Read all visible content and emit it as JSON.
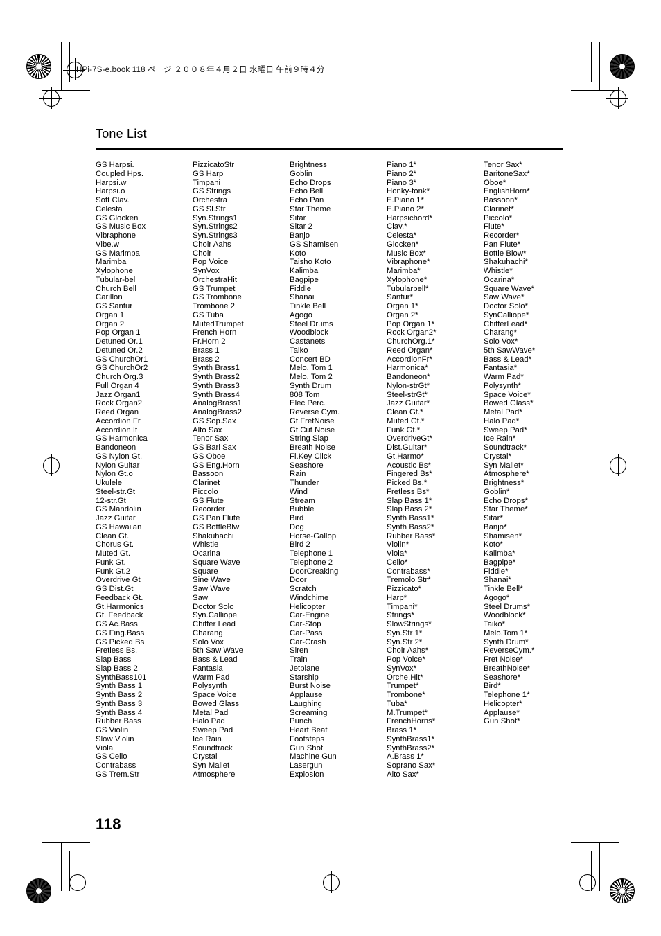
{
  "imposition": {
    "text": "HPi-7S-e.book  118 ページ  ２００８年４月２日  水曜日  午前９時４分"
  },
  "document": {
    "title": "Tone List",
    "page_number": "118"
  },
  "columns": [
    {
      "id": "column-1",
      "items": [
        "GS Harpsi.",
        "Coupled Hps.",
        "Harpsi.w",
        "Harpsi.o",
        "Soft Clav.",
        "Celesta",
        "GS Glocken",
        "GS Music Box",
        "Vibraphone",
        "Vibe.w",
        "GS Marimba",
        "Marimba",
        "Xylophone",
        "Tubular-bell",
        "Church Bell",
        "Carillon",
        "GS Santur",
        "Organ 1",
        "Organ 2",
        "Pop Organ 1",
        "Detuned Or.1",
        "Detuned Or.2",
        "GS ChurchOr1",
        "GS ChurchOr2",
        "Church Org.3",
        "Full Organ 4",
        "Jazz Organ1",
        "Rock Organ2",
        "Reed Organ",
        "Accordion Fr",
        "Accordion It",
        "GS Harmonica",
        "Bandoneon",
        "GS Nylon Gt.",
        "Nylon Guitar",
        "Nylon Gt.o",
        "Ukulele",
        "Steel-str.Gt",
        "12-str.Gt",
        "GS Mandolin",
        "Jazz Guitar",
        "GS Hawaiian",
        "Clean Gt.",
        "Chorus Gt.",
        "Muted Gt.",
        "Funk Gt.",
        "Funk Gt.2",
        "Overdrive Gt",
        "GS Dist.Gt",
        "Feedback Gt.",
        "Gt.Harmonics",
        "Gt. Feedback",
        "GS Ac.Bass",
        "GS Fing.Bass",
        "GS Picked Bs",
        "Fretless Bs.",
        "Slap Bass",
        "Slap Bass 2",
        "SynthBass101",
        "Synth Bass 1",
        "Synth Bass 2",
        "Synth Bass 3",
        "Synth Bass 4",
        "Rubber Bass",
        "GS Violin",
        "Slow Violin",
        "Viola",
        "GS Cello",
        "Contrabass",
        "GS Trem.Str"
      ]
    },
    {
      "id": "column-2",
      "items": [
        "PizzicatoStr",
        "GS Harp",
        "Timpani",
        "GS Strings",
        "Orchestra",
        "GS Sl.Str",
        "Syn.Strings1",
        "Syn.Strings2",
        "Syn.Strings3",
        "Choir Aahs",
        "Choir",
        "Pop Voice",
        "SynVox",
        "OrchestraHit",
        "GS Trumpet",
        "GS Trombone",
        "Trombone 2",
        "GS Tuba",
        "MutedTrumpet",
        "French Horn",
        "Fr.Horn 2",
        "Brass 1",
        "Brass 2",
        "Synth Brass1",
        "Synth Brass2",
        "Synth Brass3",
        "Synth Brass4",
        "AnalogBrass1",
        "AnalogBrass2",
        "GS Sop.Sax",
        "Alto Sax",
        "Tenor Sax",
        "GS Bari Sax",
        "GS Oboe",
        "GS Eng.Horn",
        "Bassoon",
        "Clarinet",
        "Piccolo",
        "GS Flute",
        "Recorder",
        "GS Pan Flute",
        "GS BottleBlw",
        "Shakuhachi",
        "Whistle",
        "Ocarina",
        "Square Wave",
        "Square",
        "Sine Wave",
        "Saw Wave",
        "Saw",
        "Doctor Solo",
        "Syn.Calliope",
        "Chiffer Lead",
        "Charang",
        "Solo Vox",
        "5th Saw Wave",
        "Bass & Lead",
        "Fantasia",
        "Warm Pad",
        "Polysynth",
        "Space Voice",
        "Bowed Glass",
        "Metal Pad",
        "Halo Pad",
        "Sweep Pad",
        "Ice Rain",
        "Soundtrack",
        "Crystal",
        "Syn Mallet",
        "Atmosphere"
      ]
    },
    {
      "id": "column-3",
      "items": [
        "Brightness",
        "Goblin",
        "Echo Drops",
        "Echo Bell",
        "Echo Pan",
        "Star Theme",
        "Sitar",
        "Sitar 2",
        "Banjo",
        "GS Shamisen",
        "Koto",
        "Taisho Koto",
        "Kalimba",
        "Bagpipe",
        "Fiddle",
        "Shanai",
        "Tinkle Bell",
        "Agogo",
        "Steel Drums",
        "Woodblock",
        "Castanets",
        "Taiko",
        "Concert BD",
        "Melo. Tom 1",
        "Melo. Tom 2",
        "Synth Drum",
        "808 Tom",
        "Elec Perc.",
        "Reverse Cym.",
        "Gt.FretNoise",
        "Gt.Cut Noise",
        "String Slap",
        "Breath Noise",
        "Fl.Key Click",
        "Seashore",
        "Rain",
        "Thunder",
        "Wind",
        "Stream",
        "Bubble",
        "Bird",
        "Dog",
        "Horse-Gallop",
        "Bird 2",
        "Telephone 1",
        "Telephone 2",
        "DoorCreaking",
        "Door",
        "Scratch",
        "Windchime",
        "Helicopter",
        "Car-Engine",
        "Car-Stop",
        "Car-Pass",
        "Car-Crash",
        "Siren",
        "Train",
        "Jetplane",
        "Starship",
        "Burst Noise",
        "Applause",
        "Laughing",
        "Screaming",
        "Punch",
        "Heart Beat",
        "Footsteps",
        "Gun Shot",
        "Machine Gun",
        "Lasergun",
        "Explosion"
      ]
    },
    {
      "id": "column-4",
      "items": [
        "Piano 1*",
        "Piano 2*",
        "Piano 3*",
        "Honky-tonk*",
        "E.Piano 1*",
        "E.Piano 2*",
        "Harpsichord*",
        "Clav.*",
        "Celesta*",
        "Glocken*",
        "Music Box*",
        "Vibraphone*",
        "Marimba*",
        "Xylophone*",
        "Tubularbell*",
        "Santur*",
        "Organ 1*",
        "Organ 2*",
        "Pop Organ 1*",
        "Rock Organ2*",
        "ChurchOrg.1*",
        "Reed Organ*",
        "AccordionFr*",
        "Harmonica*",
        "Bandoneon*",
        "Nylon-strGt*",
        "Steel-strGt*",
        "Jazz Guitar*",
        "Clean Gt.*",
        "Muted Gt.*",
        "Funk Gt.*",
        "OverdriveGt*",
        "Dist.Guitar*",
        "Gt.Harmo*",
        "Acoustic Bs*",
        "Fingered Bs*",
        "Picked Bs.*",
        "Fretless Bs*",
        "Slap Bass 1*",
        "Slap Bass 2*",
        "Synth Bass1*",
        "Synth Bass2*",
        "Rubber Bass*",
        "Violin*",
        "Viola*",
        "Cello*",
        "Contrabass*",
        "Tremolo Str*",
        "Pizzicato*",
        "Harp*",
        "Timpani*",
        "Strings*",
        "SlowStrings*",
        "Syn.Str 1*",
        "Syn.Str 2*",
        "Choir Aahs*",
        "Pop Voice*",
        "SynVox*",
        "Orche.Hit*",
        "Trumpet*",
        "Trombone*",
        "Tuba*",
        "M.Trumpet*",
        "FrenchHorns*",
        "Brass 1*",
        "SynthBrass1*",
        "SynthBrass2*",
        "A.Brass 1*",
        "Soprano Sax*",
        "Alto Sax*"
      ]
    },
    {
      "id": "column-5",
      "items": [
        "Tenor Sax*",
        "BaritoneSax*",
        "Oboe*",
        "EnglishHorn*",
        "Bassoon*",
        "Clarinet*",
        "Piccolo*",
        "Flute*",
        "Recorder*",
        "Pan Flute*",
        "Bottle Blow*",
        "Shakuhachi*",
        "Whistle*",
        "Ocarina*",
        "Square Wave*",
        "Saw Wave*",
        "Doctor Solo*",
        "SynCalliope*",
        "ChifferLead*",
        "Charang*",
        "Solo Vox*",
        "5th SawWave*",
        "Bass & Lead*",
        "Fantasia*",
        "Warm Pad*",
        "Polysynth*",
        "Space Voice*",
        "Bowed Glass*",
        "Metal Pad*",
        "Halo Pad*",
        "Sweep Pad*",
        "Ice Rain*",
        "Soundtrack*",
        "Crystal*",
        "Syn Mallet*",
        "Atmosphere*",
        "Brightness*",
        "Goblin*",
        "Echo Drops*",
        "Star Theme*",
        "Sitar*",
        "Banjo*",
        "Shamisen*",
        "Koto*",
        "Kalimba*",
        "Bagpipe*",
        "Fiddle*",
        "Shanai*",
        "Tinkle Bell*",
        "Agogo*",
        "Steel Drums*",
        "Woodblock*",
        "Taiko*",
        "Melo.Tom 1*",
        "Synth Drum*",
        "ReverseCym.*",
        "Fret Noise*",
        "BreathNoise*",
        "Seashore*",
        "Bird*",
        "Telephone 1*",
        "Helicopter*",
        "Applause*",
        "Gun Shot*"
      ]
    }
  ]
}
